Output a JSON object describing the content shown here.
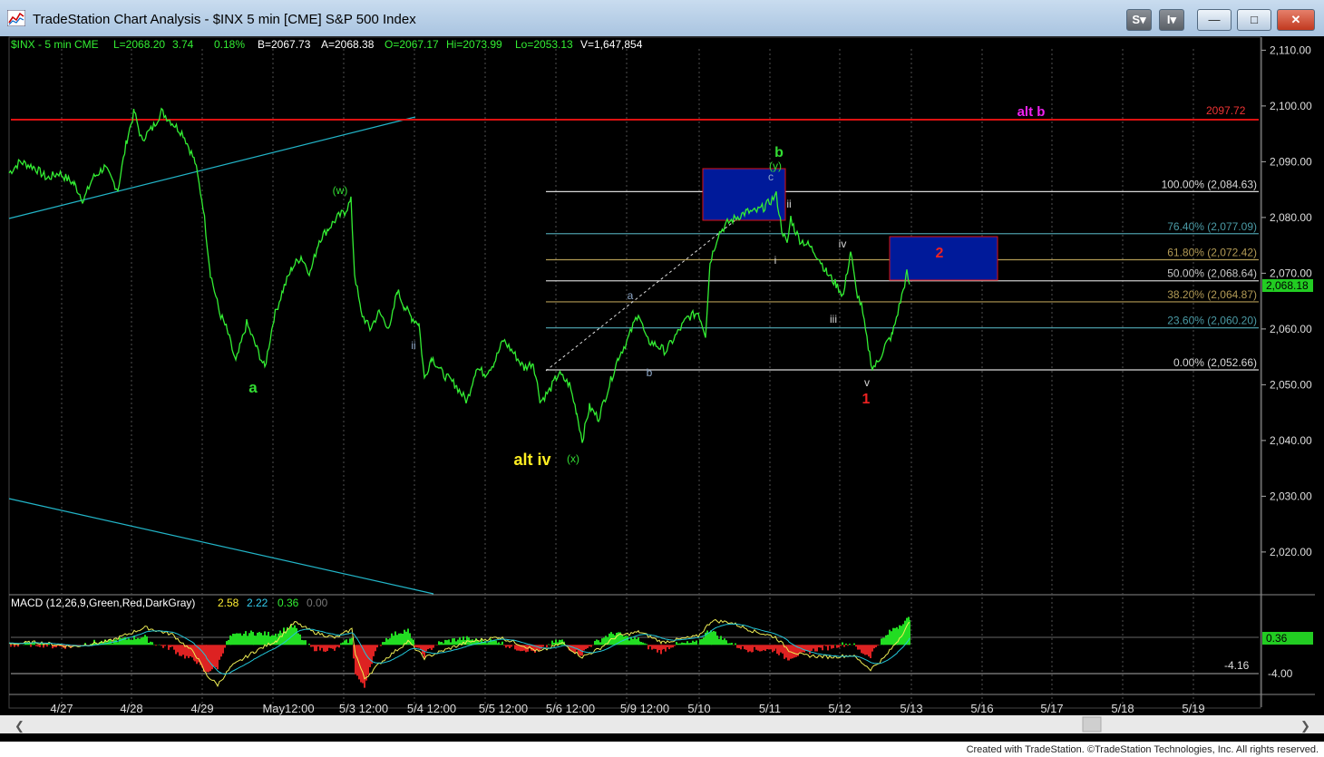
{
  "window": {
    "title": "TradeStation Chart Analysis - $INX 5 min [CME] S&P 500 Index",
    "buttons": {
      "s": "S",
      "i": "I",
      "minimize": "—",
      "maximize": "□",
      "close": "✕"
    },
    "icon": "chart-app-icon"
  },
  "header": {
    "symbol": "$INX - 5 min CME",
    "last": "L=2068.20",
    "change": "3.74",
    "pct": "0.18%",
    "bid": "B=2067.73",
    "ask": "A=2068.38",
    "open": "O=2067.17",
    "high": "Hi=2073.99",
    "low": "Lo=2053.13",
    "volume": "V=1,647,854"
  },
  "chart_data": {
    "type": "line",
    "ylim": [
      2012.5,
      2112.5
    ],
    "y_ticks": [
      2110,
      2100,
      2090,
      2080,
      2070,
      2060,
      2050,
      2040,
      2030,
      2020
    ],
    "y_tick_labels": [
      "2,110.00",
      "2,100.00",
      "2,090.00",
      "2,080.00",
      "2,070.00",
      "2,060.00",
      "2,050.00",
      "2,040.00",
      "2,030.00",
      "2,020.00"
    ],
    "x_tick_labels": [
      "4/27",
      "4/28",
      "4/29",
      "May12:00",
      "5/3 12:00",
      "5/4 12:00",
      "5/5 12:00",
      "5/6 12:00",
      "5/9 12:00",
      "5/10",
      "5/11",
      "5/12",
      "5/13",
      "5/16",
      "5/17",
      "5/18",
      "5/19"
    ],
    "price_series": [
      [
        0,
        2088
      ],
      [
        12,
        2090
      ],
      [
        28,
        2089
      ],
      [
        42,
        2087
      ],
      [
        55,
        2088
      ],
      [
        72,
        2086
      ],
      [
        82,
        2083
      ],
      [
        92,
        2087
      ],
      [
        105,
        2089
      ],
      [
        120,
        2085
      ],
      [
        130,
        2094
      ],
      [
        138,
        2099
      ],
      [
        146,
        2094
      ],
      [
        158,
        2096
      ],
      [
        168,
        2099
      ],
      [
        180,
        2097
      ],
      [
        192,
        2095
      ],
      [
        205,
        2090
      ],
      [
        214,
        2082
      ],
      [
        222,
        2070
      ],
      [
        232,
        2063
      ],
      [
        240,
        2060
      ],
      [
        250,
        2054
      ],
      [
        262,
        2061
      ],
      [
        272,
        2057
      ],
      [
        282,
        2053
      ],
      [
        292,
        2062
      ],
      [
        302,
        2067
      ],
      [
        312,
        2071
      ],
      [
        322,
        2073
      ],
      [
        332,
        2070
      ],
      [
        342,
        2076
      ],
      [
        352,
        2078
      ],
      [
        362,
        2080
      ],
      [
        370,
        2081
      ],
      [
        377,
        2083
      ],
      [
        381,
        2070
      ],
      [
        388,
        2063
      ],
      [
        398,
        2060
      ],
      [
        408,
        2063
      ],
      [
        420,
        2060
      ],
      [
        428,
        2067
      ],
      [
        436,
        2064
      ],
      [
        444,
        2062
      ],
      [
        452,
        2061
      ],
      [
        458,
        2051
      ],
      [
        466,
        2055
      ],
      [
        478,
        2052
      ],
      [
        492,
        2050
      ],
      [
        505,
        2047
      ],
      [
        515,
        2053
      ],
      [
        525,
        2052
      ],
      [
        535,
        2054
      ],
      [
        545,
        2058
      ],
      [
        555,
        2056
      ],
      [
        568,
        2053
      ],
      [
        578,
        2054
      ],
      [
        586,
        2047
      ],
      [
        596,
        2049
      ],
      [
        606,
        2052
      ],
      [
        618,
        2050
      ],
      [
        626,
        2045
      ],
      [
        632,
        2040
      ],
      [
        640,
        2046
      ],
      [
        650,
        2044
      ],
      [
        662,
        2050
      ],
      [
        672,
        2055
      ],
      [
        682,
        2058
      ],
      [
        694,
        2063
      ],
      [
        703,
        2058
      ],
      [
        715,
        2057
      ],
      [
        724,
        2056
      ],
      [
        736,
        2059
      ],
      [
        748,
        2062
      ],
      [
        760,
        2063
      ],
      [
        768,
        2059
      ],
      [
        773,
        2072
      ],
      [
        782,
        2077
      ],
      [
        792,
        2079
      ],
      [
        802,
        2080
      ],
      [
        813,
        2081
      ],
      [
        823,
        2081
      ],
      [
        834,
        2082
      ],
      [
        846,
        2084
      ],
      [
        852,
        2078
      ],
      [
        858,
        2075
      ],
      [
        862,
        2080
      ],
      [
        866,
        2078
      ],
      [
        872,
        2076
      ],
      [
        882,
        2075
      ],
      [
        892,
        2073
      ],
      [
        902,
        2070
      ],
      [
        912,
        2068
      ],
      [
        920,
        2066
      ],
      [
        928,
        2074
      ],
      [
        934,
        2067
      ],
      [
        940,
        2064
      ],
      [
        946,
        2058
      ],
      [
        952,
        2053
      ],
      [
        958,
        2054
      ],
      [
        966,
        2057
      ],
      [
        974,
        2059
      ],
      [
        980,
        2063
      ],
      [
        986,
        2067
      ],
      [
        990,
        2070
      ],
      [
        993,
        2068
      ]
    ],
    "macd_series": [
      [
        0,
        0.1
      ],
      [
        30,
        0.3
      ],
      [
        70,
        -0.2
      ],
      [
        110,
        0.4
      ],
      [
        150,
        2.0
      ],
      [
        180,
        1.2
      ],
      [
        205,
        -1.0
      ],
      [
        218,
        -3.5
      ],
      [
        230,
        -4.6
      ],
      [
        245,
        -2.5
      ],
      [
        270,
        -0.8
      ],
      [
        295,
        0.5
      ],
      [
        315,
        2.6
      ],
      [
        335,
        1.5
      ],
      [
        360,
        0.8
      ],
      [
        378,
        1.8
      ],
      [
        382,
        -1.0
      ],
      [
        392,
        -3.9
      ],
      [
        410,
        -2.0
      ],
      [
        440,
        0.4
      ],
      [
        458,
        -1.5
      ],
      [
        475,
        -0.8
      ],
      [
        505,
        0.3
      ],
      [
        540,
        0.9
      ],
      [
        560,
        0.2
      ],
      [
        585,
        -0.8
      ],
      [
        610,
        0.2
      ],
      [
        632,
        -1.4
      ],
      [
        650,
        -0.5
      ],
      [
        670,
        1.0
      ],
      [
        695,
        1.5
      ],
      [
        720,
        0.3
      ],
      [
        760,
        1.0
      ],
      [
        775,
        2.8
      ],
      [
        795,
        2.6
      ],
      [
        820,
        1.6
      ],
      [
        845,
        0.9
      ],
      [
        860,
        -0.6
      ],
      [
        875,
        -1.2
      ],
      [
        905,
        -1.4
      ],
      [
        930,
        -1.2
      ],
      [
        950,
        -2.8
      ],
      [
        965,
        -1.5
      ],
      [
        980,
        0.5
      ],
      [
        993,
        2.58
      ]
    ],
    "macd_label": "MACD (12,26,9,Green,Red,DarkGray)",
    "macd_values": [
      "2.58",
      "2.22",
      "0.36",
      "0.00"
    ],
    "macd_axis_label": "-4.00",
    "macd_ylim": [
      -5.5,
      4.0
    ],
    "last_price": "2,068.18",
    "last_macd": "0.36",
    "alt_b_value": "2097.72",
    "fib_levels": [
      {
        "label": "100.00% (2,084.63)",
        "value": 2084.63,
        "color": "#d8d8d8"
      },
      {
        "label": "76.40% (2,077.09)",
        "value": 2077.09,
        "color": "#4a9aa5"
      },
      {
        "label": "61.80% (2,072.42)",
        "value": 2072.42,
        "color": "#b29a55"
      },
      {
        "label": "50.00% (2,068.64)",
        "value": 2068.64,
        "color": "#c8c8c8"
      },
      {
        "label": "38.20% (2,064.87)",
        "value": 2064.87,
        "color": "#b29a55"
      },
      {
        "label": "23.60% (2,060.20)",
        "value": 2060.2,
        "color": "#4a9aa5"
      },
      {
        "label": "0.00% (2,052.66)",
        "value": 2052.66,
        "color": "#d8d8d8"
      }
    ],
    "macd_level_label": "-4.16",
    "wave_labels": [
      {
        "text": "a",
        "color": "#33dd33"
      },
      {
        "text": "(w)",
        "color": "#33dd33"
      },
      {
        "text": "ii",
        "color": "#8fa8c8"
      },
      {
        "text": "alt iv",
        "color": "#ffee22"
      },
      {
        "text": "(x)",
        "color": "#33dd33"
      },
      {
        "text": "a",
        "color": "#8fa8c8"
      },
      {
        "text": "b",
        "color": "#8fa8c8"
      },
      {
        "text": "b",
        "color": "#33dd33"
      },
      {
        "text": "(y)",
        "color": "#33dd33"
      },
      {
        "text": "c",
        "color": "#8fa8c8"
      },
      {
        "text": "ii",
        "color": "#d8d8d8"
      },
      {
        "text": "i",
        "color": "#d8d8d8"
      },
      {
        "text": "iv",
        "color": "#d8d8d8"
      },
      {
        "text": "iii",
        "color": "#d8d8d8"
      },
      {
        "text": "v",
        "color": "#d8d8d8"
      },
      {
        "text": "1",
        "color": "#ee2222"
      },
      {
        "text": "2",
        "color": "#ee2222"
      },
      {
        "text": "alt b",
        "color": "#ee22ee"
      }
    ]
  },
  "colors": {
    "price": "#33ee33",
    "grid": "#5a5a5a",
    "axis_text": "#dddddd",
    "trendline": "#22b5c8",
    "resistance": "#dd1111",
    "box_fill": "#001a9a",
    "box_border": "#dd1111"
  },
  "footer": {
    "credit": "Created with TradeStation. ©TradeStation Technologies, Inc. All rights reserved."
  }
}
